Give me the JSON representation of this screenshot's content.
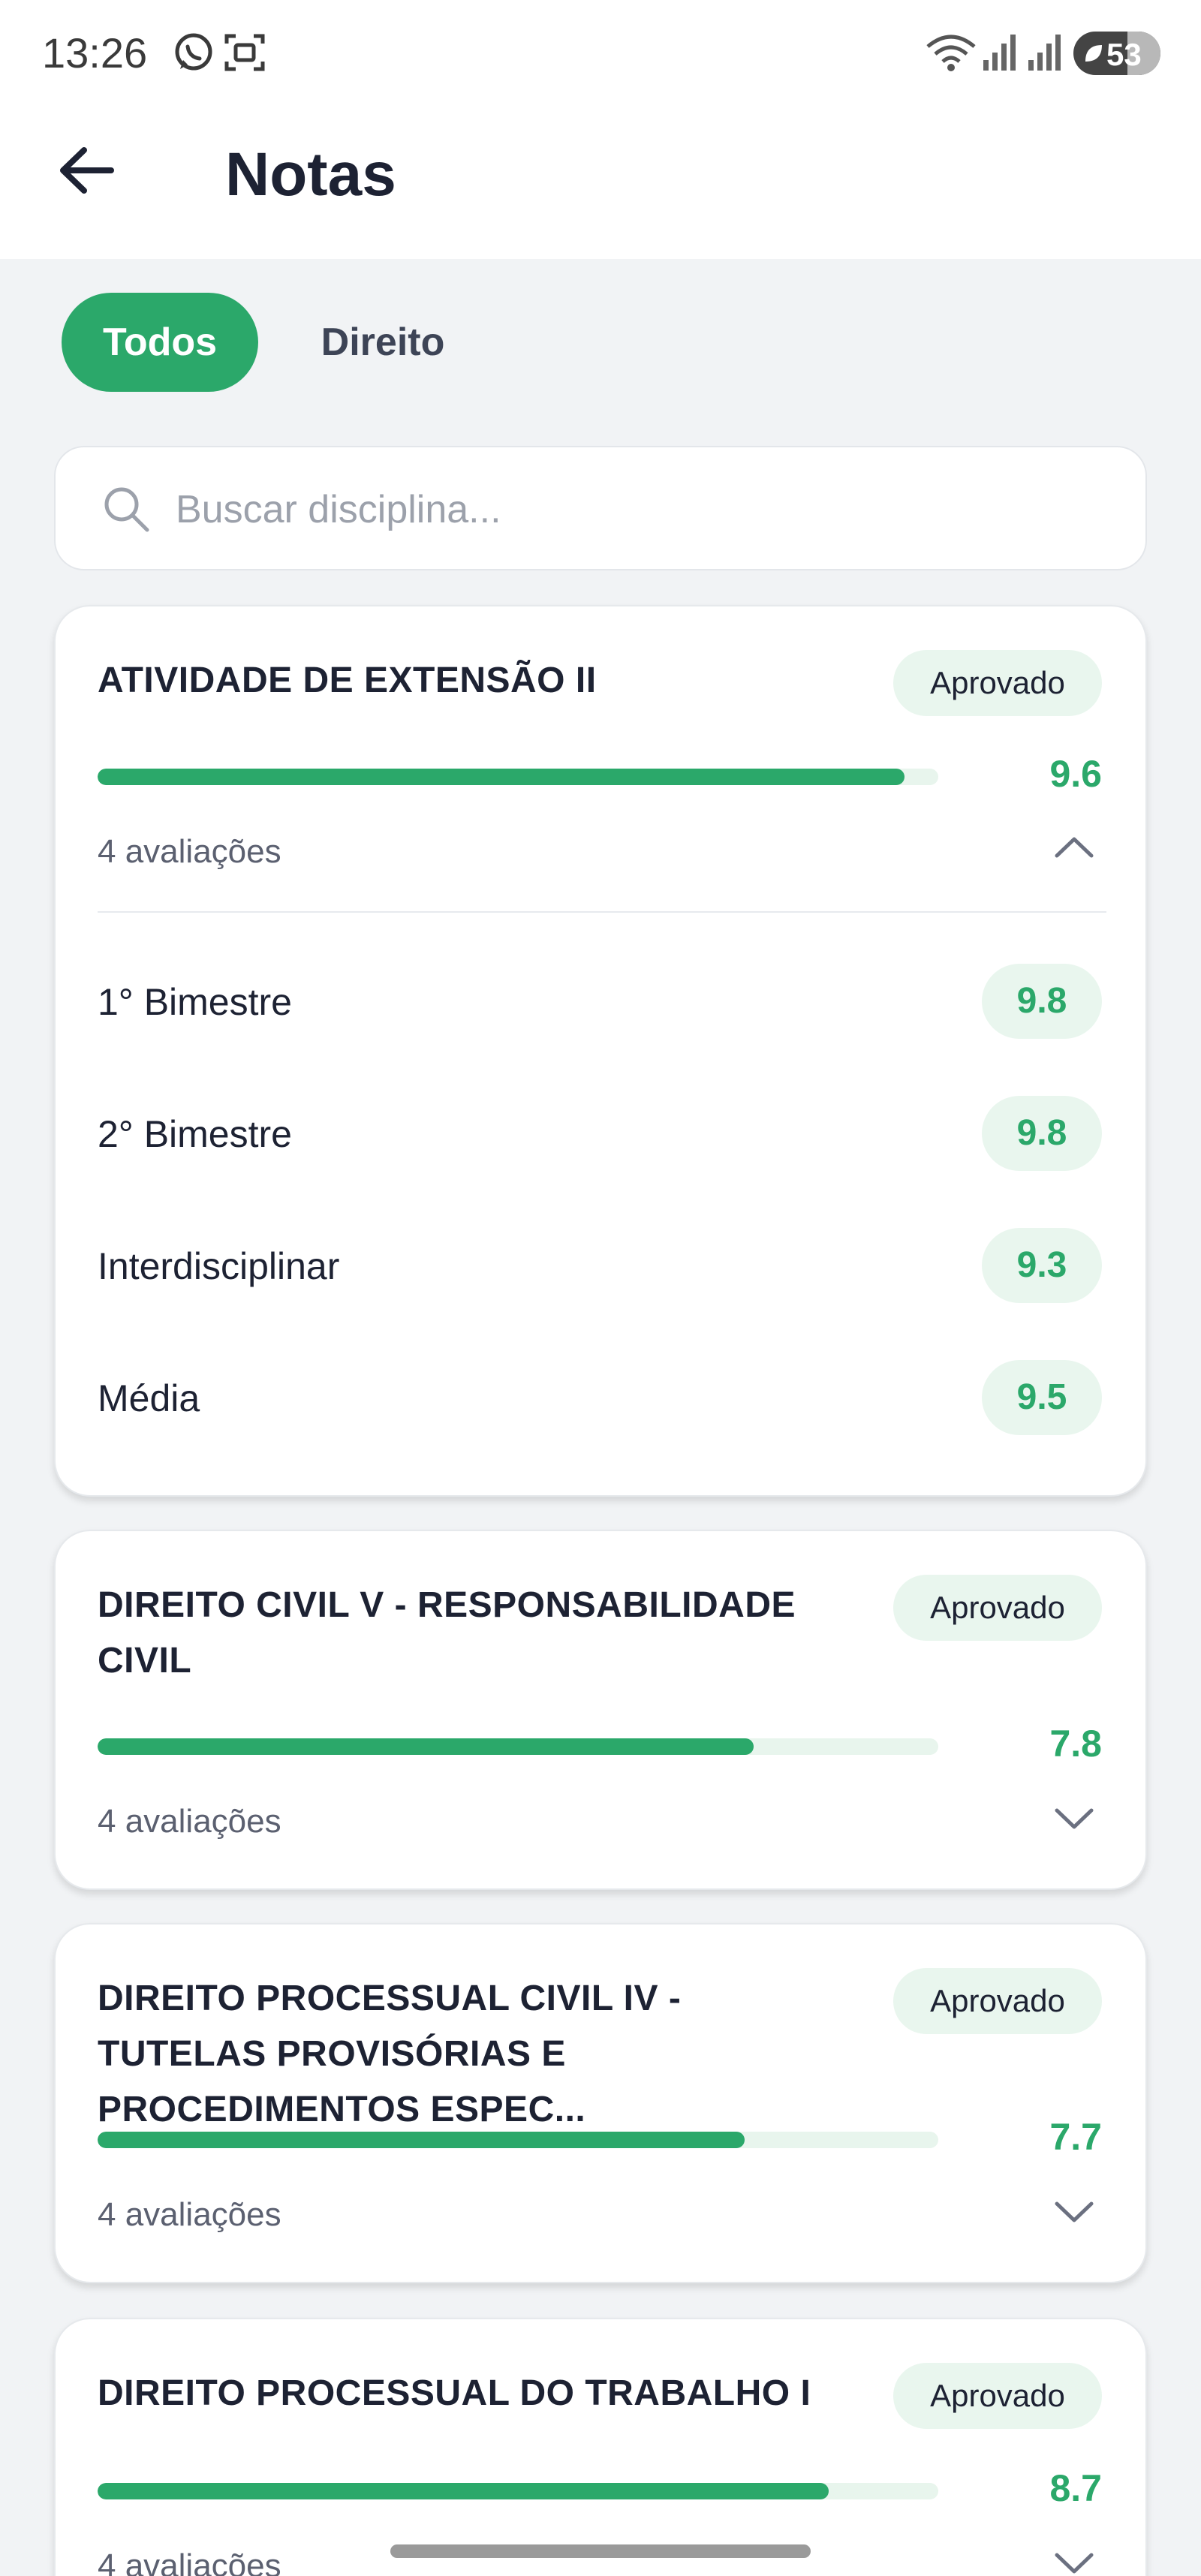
{
  "status_bar": {
    "time": "13:26",
    "battery": "53",
    "icons": [
      "whatsapp-icon",
      "screenshot-icon",
      "wifi-icon",
      "signal-icon",
      "signal-icon",
      "battery-icon"
    ]
  },
  "header": {
    "title": "Notas"
  },
  "filters": [
    {
      "label": "Todos",
      "active": true
    },
    {
      "label": "Direito",
      "active": false
    }
  ],
  "search": {
    "placeholder": "Buscar disciplina..."
  },
  "colors": {
    "accent": "#2ba86a",
    "accent_light": "#e9f6ee",
    "background": "#f1f3f5"
  },
  "courses": [
    {
      "title": "ATIVIDADE DE EXTENSÃO II",
      "status": "Aprovado",
      "grade": "9.6",
      "progress": 0.96,
      "count": "4 avaliações",
      "expanded": true,
      "items": [
        {
          "label": "1° Bimestre",
          "value": "9.8"
        },
        {
          "label": "2° Bimestre",
          "value": "9.8"
        },
        {
          "label": "Interdisciplinar",
          "value": "9.3"
        },
        {
          "label": "Média",
          "value": "9.5"
        }
      ]
    },
    {
      "title": "DIREITO CIVIL V - RESPONSABILIDADE CIVIL",
      "status": "Aprovado",
      "grade": "7.8",
      "progress": 0.78,
      "count": "4 avaliações",
      "expanded": false
    },
    {
      "title": "DIREITO PROCESSUAL CIVIL IV - TUTELAS PROVISÓRIAS E PROCEDIMENTOS ESPEC...",
      "status": "Aprovado",
      "grade": "7.7",
      "progress": 0.77,
      "count": "4 avaliações",
      "expanded": false
    },
    {
      "title": "DIREITO PROCESSUAL DO TRABALHO I",
      "status": "Aprovado",
      "grade": "8.7",
      "progress": 0.87,
      "count": "4 avaliações",
      "expanded": false
    }
  ]
}
